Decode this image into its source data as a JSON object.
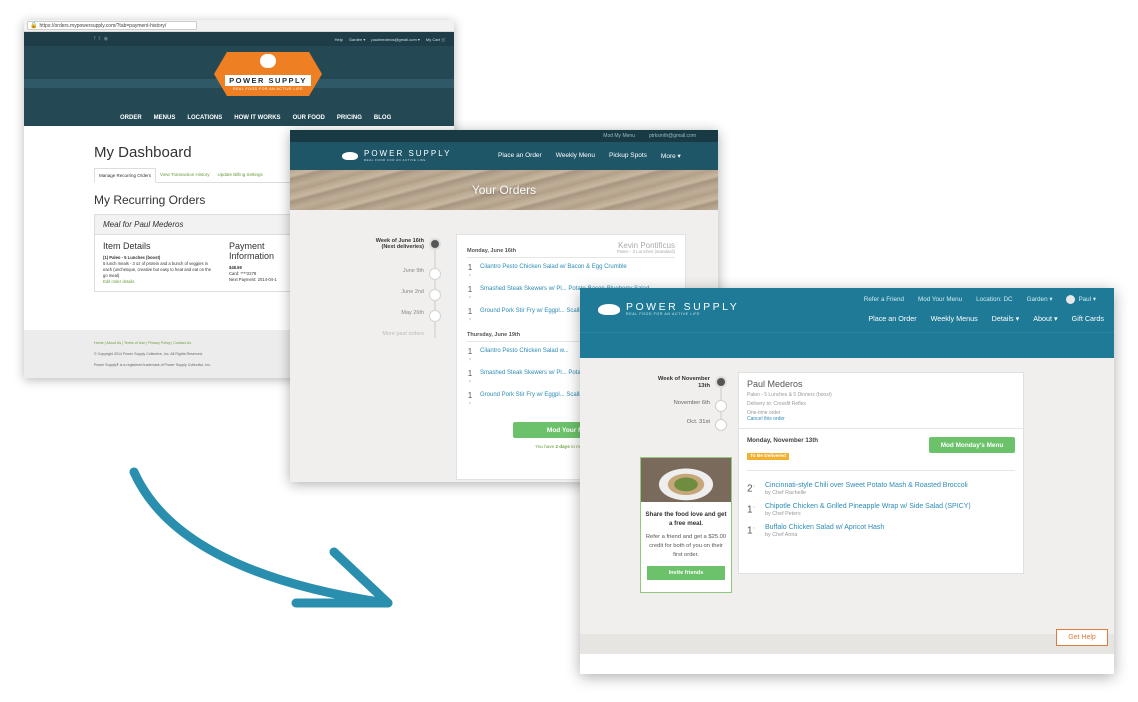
{
  "shot1": {
    "url": "https://orders.mypowersupply.com/?tab=payment-history/",
    "top_links": [
      "Help",
      "Garden ▾",
      "paulmederos@gmail.com ▾",
      "My Cart 🛒"
    ],
    "social_icons": [
      "facebook-icon",
      "twitter-icon",
      "pinterest-icon"
    ],
    "logo_text": "POWER SUPPLY",
    "logo_tagline": "REAL FOOD FOR AN ACTIVE LIFE",
    "nav": [
      "ORDER",
      "MENUS",
      "LOCATIONS",
      "HOW IT WORKS",
      "OUR FOOD",
      "PRICING",
      "BLOG"
    ],
    "title": "My Dashboard",
    "tabs": [
      "Manage Recurring Orders",
      "View Transaction History",
      "Update Billing Settings"
    ],
    "section_title": "My Recurring Orders",
    "panel_title": "Meal for Paul Mederos",
    "item_details_heading": "Item Details",
    "item_line": "(1) Paleo - 5 Lunches (boost)",
    "item_desc": "5 lunch meals - 3 oz of protein and a bunch of veggies in each (unchesque, creative but easy to heat and eat on the go meal)",
    "edit_link": "Edit order details",
    "payment_heading": "Payment Information",
    "payment_amount": "$48.69",
    "payment_card": "Card: ****2278",
    "payment_next": "Next Payment: 2014-04-1",
    "footer_links": "Home | About Us | Terms of Use | Privacy Policy | Contact Us",
    "footer_copyright": "© Copyright 2014 Power Supply Collective, Inc. All Rights Reserved.",
    "footer_trademark": "Power Supply® is a registered trademark of Power Supply Collective, Inc."
  },
  "shot2": {
    "top_links": [
      "Mod My Menu",
      "ptrksmth@gmail.com"
    ],
    "logo_text": "POWER SUPPLY",
    "logo_tagline": "REAL FOOD FOR AN ACTIVE LIFE",
    "nav": [
      "Place an Order",
      "Weekly Menu",
      "Pickup Spots",
      "More ▾"
    ],
    "banner_title": "Your Orders",
    "timeline_first_line1": "Week of June 16th",
    "timeline_first_line2": "(Next deliveries)",
    "timeline": [
      "June 9th",
      "June 2nd",
      "May 26th"
    ],
    "timeline_more": "More past orders",
    "customer_name": "Kevin Pontificus",
    "customer_plan": "Paleo - 3 Lunches (standard)",
    "days": [
      {
        "label": "Monday, June 16th",
        "items": [
          {
            "qty": "1",
            "name": "Cilantro Pesto Chicken Salad w/ Bacon & Egg Crumble"
          },
          {
            "qty": "1",
            "name": "Smashed Steak Skewers w/ Pl... Potato-Bacon-Blueberry Salad"
          },
          {
            "qty": "1",
            "name": "Ground Pork Stir Fry w/ Eggpl... Scallions (NEW)"
          }
        ]
      },
      {
        "label": "Thursday, June 19th",
        "items": [
          {
            "qty": "1",
            "name": "Cilantro Pesto Chicken Salad w..."
          },
          {
            "qty": "1",
            "name": "Smashed Steak Skewers w/ Pl... Potato-Bacon-Blueberry Salad"
          },
          {
            "qty": "1",
            "name": "Ground Pork Stir Fry w/ Eggpl... Scallions (NEW)"
          }
        ]
      }
    ],
    "mod_button": "Mod Your Menu",
    "note_prefix": "You have",
    "note_days": "2 days",
    "note_suffix": "to mod your me..."
  },
  "shot3": {
    "util_links": [
      "Refer a Friend",
      "Mod Your Menu",
      "Location: DC",
      "Garden ▾"
    ],
    "user_name": "Paul ▾",
    "logo_text": "POWER SUPPLY",
    "logo_tagline": "REAL FOOD FOR AN ACTIVE LIFE",
    "nav": [
      "Place an Order",
      "Weekly Menus",
      "Details ▾",
      "About ▾",
      "Gift Cards"
    ],
    "timeline_first_line1": "Week of November",
    "timeline_first_line2": "13th",
    "timeline": [
      "November 6th",
      "Oct. 31st"
    ],
    "promo_title": "Share the food love and get a free meal.",
    "promo_text": "Refer a friend and get a $25.00 credit for both of you on their first order.",
    "promo_button": "Invite friends",
    "customer_name": "Paul Mederos",
    "meta": [
      "Paleo - 5 Lunches & 5 Dinners (boost)",
      "Delivery to: Crossfit Reflex",
      "One-time order"
    ],
    "cancel_link": "Cancel this order",
    "day_label": "Monday, November 13th",
    "status_badge": "To Be Delivered",
    "mod_button": "Mod Monday's Menu",
    "items": [
      {
        "qty": "2",
        "name": "Cincinnati-style Chili over Sweet Potato Mash & Roasted Broccoli",
        "chef": "by Chef Rachelle"
      },
      {
        "qty": "1",
        "name": "Chipotle Chicken & Grilled Pineapple Wrap w/ Side Salad (SPICY)",
        "chef": "by Chef Peters"
      },
      {
        "qty": "1",
        "name": "Buffalo Chicken Salad w/ Apricot Hash",
        "chef": "by Chef Anna"
      }
    ],
    "help_button": "Get Help"
  },
  "colors": {
    "arrow": "#2a8fae",
    "green_button": "#6cc26a",
    "brand_teal": "#1e7a96",
    "link_blue": "#2d8cb6",
    "badge_yellow": "#f4b02f",
    "logo_orange": "#ee7f23"
  }
}
